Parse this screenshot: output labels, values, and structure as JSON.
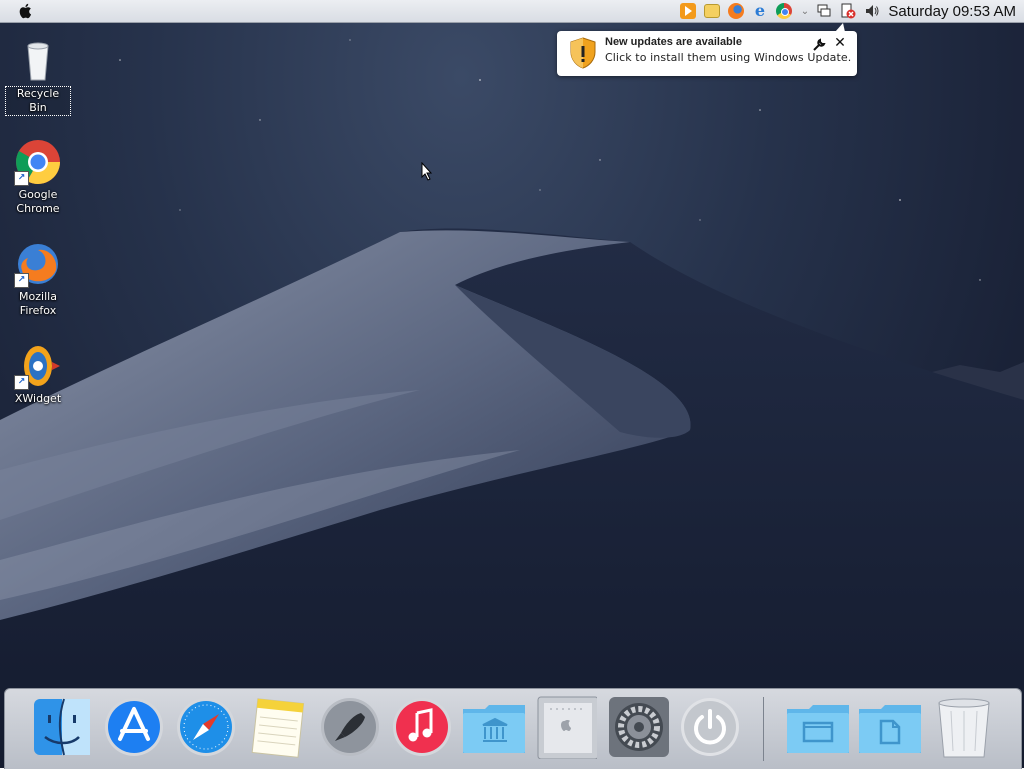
{
  "menubar": {
    "clock": "Saturday 09:53 AM",
    "tray_icons": [
      "media-player-icon",
      "file-explorer-icon",
      "firefox-icon",
      "internet-explorer-icon",
      "chrome-icon",
      "chevron-down-icon",
      "network-icon",
      "action-center-icon",
      "volume-icon"
    ]
  },
  "notification": {
    "title": "New updates are available",
    "message": "Click to install them using Windows Update."
  },
  "desktop_icons": [
    {
      "label": "Recycle Bin",
      "icon": "recycle-bin-icon"
    },
    {
      "label": "Google\nChrome",
      "icon": "chrome-icon"
    },
    {
      "label": "Mozilla\nFirefox",
      "icon": "firefox-icon"
    },
    {
      "label": "XWidget",
      "icon": "xwidget-icon"
    }
  ],
  "dock": {
    "items": [
      "finder-icon",
      "app-store-icon",
      "safari-icon",
      "notes-icon",
      "launchpad-icon",
      "itunes-icon",
      "applications-folder-icon",
      "mac-pro-icon",
      "system-preferences-icon",
      "power-icon",
      "desktop-folder-icon",
      "documents-folder-icon",
      "trash-icon"
    ]
  },
  "colors": {
    "menubar": "#dfe2e8",
    "dock": "#c8ccd3",
    "folder_blue": "#6ec3f0",
    "wallpaper_sky": "#26324b"
  }
}
